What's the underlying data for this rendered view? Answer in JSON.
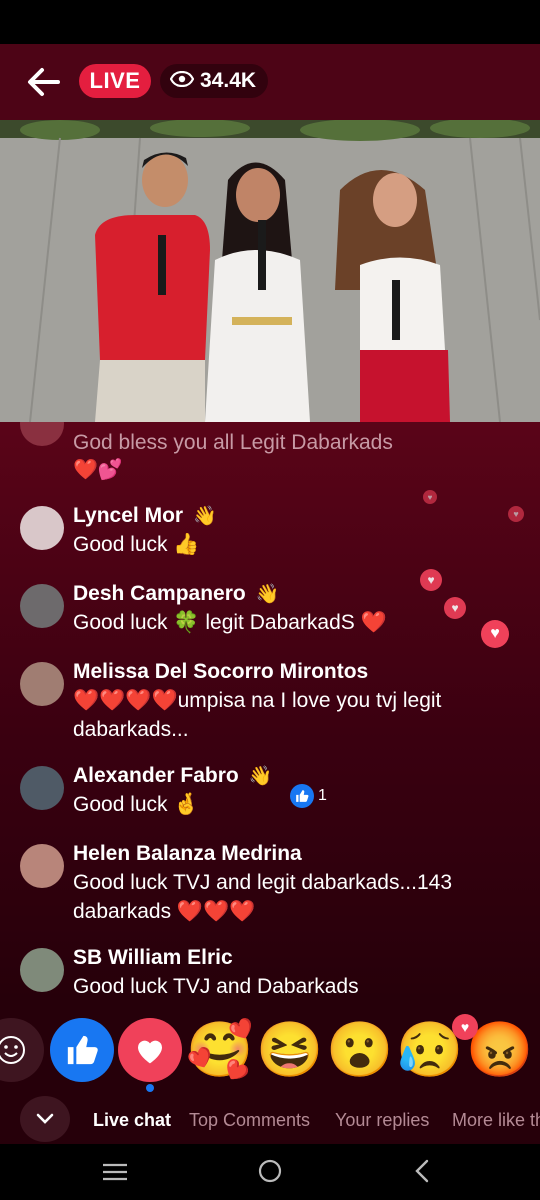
{
  "header": {
    "live_label": "LIVE",
    "viewer_count": "34.4K"
  },
  "pinned_partial": {
    "text": "God bless you all Legit Dabarkads"
  },
  "comments": [
    {
      "name": "Lyncel Mor",
      "text": "Good luck 👍"
    },
    {
      "name": "Desh Campanero",
      "text": "Good luck 🍀 legit DabarkadS ❤️"
    },
    {
      "name": "Melissa Del Socorro Mirontos",
      "text": "❤️❤️❤️❤️umpisa na I love you tvj  legit dabarkads..."
    },
    {
      "name": "Alexander Fabro",
      "text": "Good luck 🤞",
      "like_count": "1"
    },
    {
      "name": "Helen Balanza Medrina",
      "text": "Good luck TVJ and legit dabarkads...143 dabarkads ❤️❤️❤️"
    },
    {
      "name": "SB William Elric",
      "text": "Good luck TVJ and Dabarkads"
    }
  ],
  "reactions": [
    "like",
    "love",
    "care",
    "haha",
    "wow",
    "sad",
    "angry"
  ],
  "tabs": [
    "Live chat",
    "Top Comments",
    "Your replies",
    "More like this"
  ],
  "colors": {
    "background": "#4d0416",
    "live_badge": "#e41e3f",
    "like_blue": "#1877f2",
    "love_red": "#f0415a"
  }
}
